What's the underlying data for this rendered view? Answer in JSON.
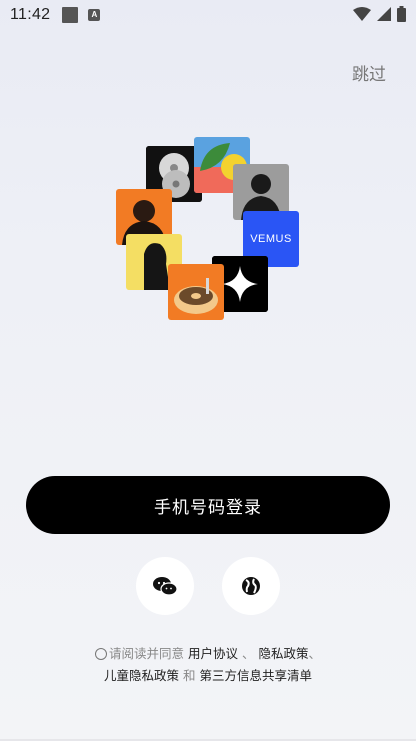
{
  "status_bar": {
    "time": "11:42",
    "icons": [
      "notification-square-icon",
      "a-app-icon",
      "wifi-icon",
      "signal-icon",
      "battery-icon"
    ]
  },
  "header": {
    "skip_label": "跳过"
  },
  "collage": {
    "vemus_label": "VEMUS",
    "tiles": [
      "cd-disc",
      "leaf-art",
      "silhouette-portrait",
      "vemus-brand",
      "sparkle-star",
      "turntable",
      "hooded-figure",
      "orange-portrait"
    ]
  },
  "actions": {
    "phone_login_label": "手机号码登录",
    "wechat_icon": "wechat-icon",
    "globe_icon": "globe-icon"
  },
  "terms": {
    "prefix": "请阅读并同意",
    "user_agreement": "用户协议",
    "sep1": "、",
    "privacy_policy": "隐私政策",
    "sep2": "、",
    "children_privacy": "儿童隐私政策",
    "and": "和",
    "third_party": "第三方信息共享清单"
  },
  "colors": {
    "primary_button": "#000000",
    "background": "#eef0f6",
    "vemus_blue": "#2a55f5",
    "orange": "#f07a2a"
  }
}
